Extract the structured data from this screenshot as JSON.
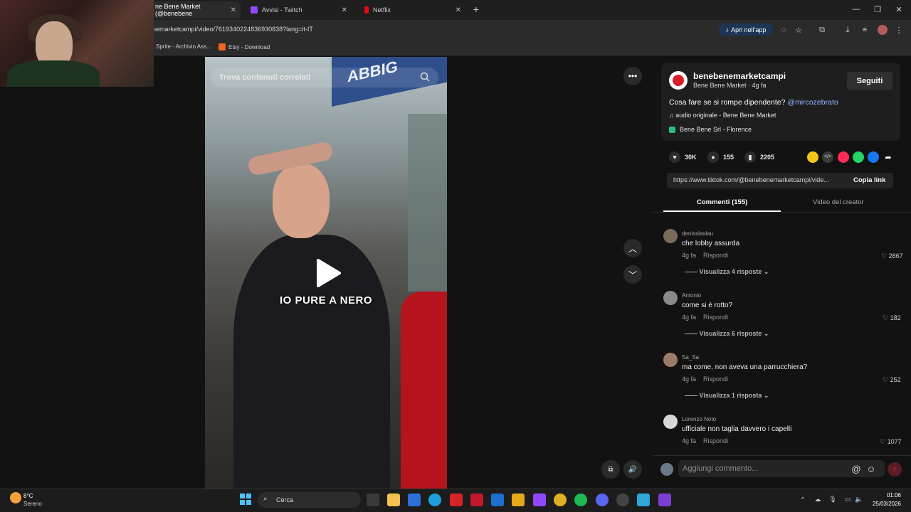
{
  "browser": {
    "tabs": [
      {
        "title": "ne Bene Market (@benebene",
        "active": true
      },
      {
        "title": "Avvisi - Twitch",
        "active": false
      },
      {
        "title": "Netflix",
        "active": false
      }
    ],
    "url": "nemarketcampi/video/7619340224836930838?lang=it-IT",
    "open_app_label": "Apri nell'app",
    "bookmarks": [
      {
        "label": "Sprite - Archivio Ass..."
      },
      {
        "label": "Etsy - Download"
      }
    ]
  },
  "video": {
    "search_placeholder": "Trova contenuti correlati",
    "caption": "IO PURE A NERO",
    "sign_text": "ABBIG"
  },
  "creator": {
    "username": "benebenemarketcampi",
    "subline": "Bene Bene Market · 4g fa",
    "follow_label": "Seguiti",
    "description": "Cosa fare se si rompe dipendente?",
    "mention": "@mircozebrato",
    "audio": "audio originale - Bene Bene Market",
    "location": "Bene Bene Srl - Florence"
  },
  "stats": {
    "likes": "30K",
    "comments": "155",
    "saves": "2205"
  },
  "link": {
    "url": "https://www.tiktok.com/@benebenemarketcampi/vide...",
    "copy_label": "Copia link"
  },
  "tabs": {
    "comments": "Commenti (155)",
    "creator_videos": "Video del creator"
  },
  "comments": [
    {
      "user": "denisslaslau",
      "text": "che lobby assurda",
      "time": "4g fa",
      "reply": "Rispondi",
      "likes": "2867",
      "replies": "Visualizza 4 risposte",
      "avatar_color": "#7a6a5a"
    },
    {
      "user": "Antonio",
      "text": "come si è rotto?",
      "time": "4g fa",
      "reply": "Rispondi",
      "likes": "182",
      "replies": "Visualizza 6 risposte",
      "avatar_color": "#8a8a8a"
    },
    {
      "user": "Sa_Sa",
      "text": "ma come, non aveva una parrucchiera?",
      "time": "4g fa",
      "reply": "Rispondi",
      "likes": "252",
      "replies": "Visualizza 1 risposta",
      "avatar_color": "#9a7a6a"
    },
    {
      "user": "Lorenzo Noto",
      "text": "ufficiale non taglia davvero i capelli",
      "time": "4g fa",
      "reply": "Rispondi",
      "likes": "1077",
      "replies": "",
      "avatar_color": "#d8d8d8"
    }
  ],
  "comment_input_placeholder": "Aggiungi commento...",
  "taskbar": {
    "weather_temp": "8°C",
    "weather_desc": "Sereno",
    "search_label": "Cerca",
    "time": "01:06",
    "date": "25/03/2026"
  },
  "colors": {
    "accent": "#fe2c55",
    "mention": "#8fb4ff",
    "panel_bg": "#121212"
  }
}
